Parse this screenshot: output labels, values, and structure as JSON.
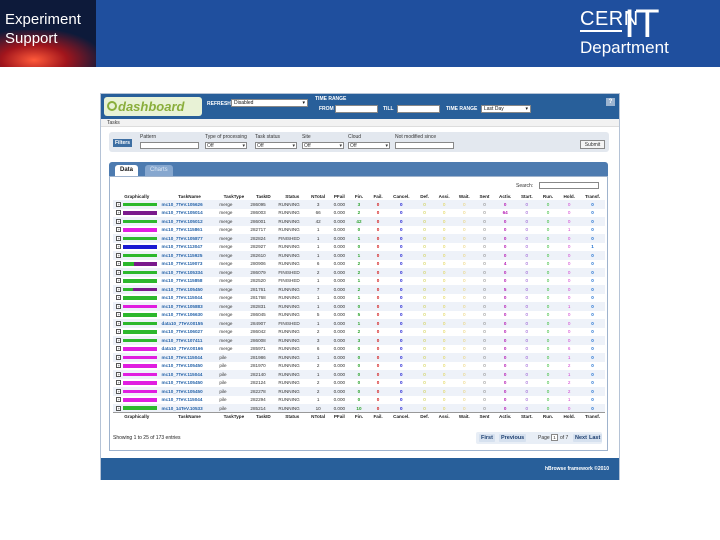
{
  "slide": {
    "left_title_line1": "Experiment",
    "left_title_line2": "Support",
    "org": "CERN",
    "org_it": "IT",
    "dept": "Department"
  },
  "toolbar": {
    "logo": "dashboard",
    "refresh_label": "REFRESH",
    "refresh_value": "Disabled",
    "time_range_title": "TIME RANGE",
    "from_label": "FROM",
    "till_label": "TILL",
    "time_range_label": "TIME RANGE",
    "time_range_value": "Last Day",
    "help": "?"
  },
  "tasks_bar": "Tasks",
  "filters": {
    "button": "Filters",
    "pattern_label": "Pattern",
    "type_label": "Type of processing",
    "type_value": "Off",
    "status_label": "Task status",
    "status_value": "Off",
    "site_label": "Site",
    "site_value": "Off",
    "cloud_label": "Cloud",
    "cloud_value": "Off",
    "notmod_label": "Not modified since",
    "submit": "Submit"
  },
  "tabs": {
    "data": "Data",
    "charts": "Charts"
  },
  "search_label": "Search:",
  "columns": [
    "Graphically",
    "TaskName",
    "TaskType",
    "TaskID",
    "Status",
    "NTotal",
    "PFail",
    "Fin.",
    "Fail.",
    "Cancel.",
    "Def.",
    "Assi.",
    "Wait.",
    "Sent",
    "Activ.",
    "Start.",
    "Run.",
    "Hold.",
    "Transf."
  ],
  "colors": {
    "green": "#2db82d",
    "purple": "#7a1a8c",
    "magenta": "#e01ee0",
    "blue": "#1a1ad2"
  },
  "rows": [
    {
      "g": [
        [
          "green",
          1
        ]
      ],
      "name": "mc10_7TeV.105626",
      "type": "merge",
      "id": "286095",
      "status": "RUNNING",
      "ntotal": "3",
      "pfail": "0.000",
      "fin": "3",
      "fail": "0",
      "canc": "0",
      "def": "0",
      "asi": "0",
      "wai": "0",
      "sen": "0",
      "act": "0",
      "sta": "0",
      "run": "0",
      "hol": "0",
      "tra": "0"
    },
    {
      "g": [
        [
          "purple",
          1
        ]
      ],
      "name": "mc10_7TeV.105014",
      "type": "merge",
      "id": "286003",
      "status": "RUNNING",
      "ntotal": "66",
      "pfail": "0.000",
      "fin": "2",
      "fail": "0",
      "canc": "0",
      "def": "0",
      "asi": "0",
      "wai": "0",
      "sen": "0",
      "act": "64",
      "sta": "0",
      "run": "0",
      "hol": "0",
      "tra": "0"
    },
    {
      "g": [
        [
          "green",
          1
        ]
      ],
      "name": "mc10_7TeV.105012",
      "type": "merge",
      "id": "286001",
      "status": "RUNNING",
      "ntotal": "42",
      "pfail": "0.000",
      "fin": "42",
      "fail": "0",
      "canc": "0",
      "def": "0",
      "asi": "0",
      "wai": "0",
      "sen": "0",
      "act": "0",
      "sta": "0",
      "run": "0",
      "hol": "0",
      "tra": "0"
    },
    {
      "g": [
        [
          "magenta",
          1
        ]
      ],
      "name": "mc10_7TeV.115861",
      "type": "merge",
      "id": "282717",
      "status": "RUNNING",
      "ntotal": "1",
      "pfail": "0.000",
      "fin": "0",
      "fail": "0",
      "canc": "0",
      "def": "0",
      "asi": "0",
      "wai": "0",
      "sen": "0",
      "act": "0",
      "sta": "0",
      "run": "0",
      "hol": "1",
      "tra": "0"
    },
    {
      "g": [
        [
          "green",
          1
        ]
      ],
      "name": "mc10_7TeV.105877",
      "type": "merge",
      "id": "282824",
      "status": "FINISHED",
      "ntotal": "1",
      "pfail": "0.000",
      "fin": "1",
      "fail": "0",
      "canc": "0",
      "def": "0",
      "asi": "0",
      "wai": "0",
      "sen": "0",
      "act": "0",
      "sta": "0",
      "run": "0",
      "hol": "0",
      "tra": "0"
    },
    {
      "g": [
        [
          "blue",
          1
        ]
      ],
      "name": "mc10_7TeV.113047",
      "type": "merge",
      "id": "282927",
      "status": "RUNNING",
      "ntotal": "1",
      "pfail": "0.000",
      "fin": "0",
      "fail": "0",
      "canc": "0",
      "def": "0",
      "asi": "0",
      "wai": "0",
      "sen": "0",
      "act": "0",
      "sta": "0",
      "run": "0",
      "hol": "0",
      "tra": "1"
    },
    {
      "g": [
        [
          "green",
          1
        ]
      ],
      "name": "mc10_7TeV.115925",
      "type": "merge",
      "id": "282610",
      "status": "RUNNING",
      "ntotal": "1",
      "pfail": "0.000",
      "fin": "1",
      "fail": "0",
      "canc": "0",
      "def": "0",
      "asi": "0",
      "wai": "0",
      "sen": "0",
      "act": "0",
      "sta": "0",
      "run": "0",
      "hol": "0",
      "tra": "0"
    },
    {
      "g": [
        [
          "green",
          0.33
        ],
        [
          "purple",
          0.67
        ]
      ],
      "name": "mc10_7TeV.119073",
      "type": "merge",
      "id": "280906",
      "status": "RUNNING",
      "ntotal": "6",
      "pfail": "0.000",
      "fin": "2",
      "fail": "0",
      "canc": "0",
      "def": "0",
      "asi": "0",
      "wai": "0",
      "sen": "0",
      "act": "4",
      "sta": "0",
      "run": "0",
      "hol": "0",
      "tra": "0"
    },
    {
      "g": [
        [
          "green",
          1
        ]
      ],
      "name": "mc10_7TeV.105334",
      "type": "merge",
      "id": "286079",
      "status": "FINISHED",
      "ntotal": "2",
      "pfail": "0.000",
      "fin": "2",
      "fail": "0",
      "canc": "0",
      "def": "0",
      "asi": "0",
      "wai": "0",
      "sen": "0",
      "act": "0",
      "sta": "0",
      "run": "0",
      "hol": "0",
      "tra": "0"
    },
    {
      "g": [
        [
          "green",
          1
        ]
      ],
      "name": "mc10_7TeV.115858",
      "type": "merge",
      "id": "282520",
      "status": "FINISHED",
      "ntotal": "1",
      "pfail": "0.000",
      "fin": "1",
      "fail": "0",
      "canc": "0",
      "def": "0",
      "asi": "0",
      "wai": "0",
      "sen": "0",
      "act": "0",
      "sta": "0",
      "run": "0",
      "hol": "0",
      "tra": "0"
    },
    {
      "g": [
        [
          "green",
          0.29
        ],
        [
          "purple",
          0.71
        ]
      ],
      "name": "mc10_7TeV.105450",
      "type": "merge",
      "id": "281761",
      "status": "RUNNING",
      "ntotal": "7",
      "pfail": "0.000",
      "fin": "2",
      "fail": "0",
      "canc": "0",
      "def": "0",
      "asi": "0",
      "wai": "0",
      "sen": "0",
      "act": "5",
      "sta": "0",
      "run": "0",
      "hol": "0",
      "tra": "0"
    },
    {
      "g": [
        [
          "green",
          1
        ]
      ],
      "name": "mc10_7TeV.115044",
      "type": "merge",
      "id": "281768",
      "status": "RUNNING",
      "ntotal": "1",
      "pfail": "0.000",
      "fin": "1",
      "fail": "0",
      "canc": "0",
      "def": "0",
      "asi": "0",
      "wai": "0",
      "sen": "0",
      "act": "0",
      "sta": "0",
      "run": "0",
      "hol": "0",
      "tra": "0"
    },
    {
      "g": [
        [
          "magenta",
          1
        ]
      ],
      "name": "mc10_7TeV.105883",
      "type": "merge",
      "id": "282831",
      "status": "RUNNING",
      "ntotal": "1",
      "pfail": "0.000",
      "fin": "0",
      "fail": "0",
      "canc": "0",
      "def": "0",
      "asi": "0",
      "wai": "0",
      "sen": "0",
      "act": "0",
      "sta": "0",
      "run": "0",
      "hol": "1",
      "tra": "0"
    },
    {
      "g": [
        [
          "green",
          1
        ]
      ],
      "name": "mc10_7TeV.106630",
      "type": "merge",
      "id": "286045",
      "status": "RUNNING",
      "ntotal": "5",
      "pfail": "0.000",
      "fin": "5",
      "fail": "0",
      "canc": "0",
      "def": "0",
      "asi": "0",
      "wai": "0",
      "sen": "0",
      "act": "0",
      "sta": "0",
      "run": "0",
      "hol": "0",
      "tra": "0"
    },
    {
      "g": [
        [
          "green",
          1
        ]
      ],
      "name": "data10_7TeV.00155",
      "type": "merge",
      "id": "284907",
      "status": "FINISHED",
      "ntotal": "1",
      "pfail": "0.000",
      "fin": "1",
      "fail": "0",
      "canc": "0",
      "def": "0",
      "asi": "0",
      "wai": "0",
      "sen": "0",
      "act": "0",
      "sta": "0",
      "run": "0",
      "hol": "0",
      "tra": "0"
    },
    {
      "g": [
        [
          "green",
          1
        ]
      ],
      "name": "mc10_7TeV.106027",
      "type": "merge",
      "id": "286042",
      "status": "RUNNING",
      "ntotal": "2",
      "pfail": "0.000",
      "fin": "2",
      "fail": "0",
      "canc": "0",
      "def": "0",
      "asi": "0",
      "wai": "0",
      "sen": "0",
      "act": "0",
      "sta": "0",
      "run": "0",
      "hol": "0",
      "tra": "0"
    },
    {
      "g": [
        [
          "green",
          1
        ]
      ],
      "name": "mc10_7TeV.107411",
      "type": "merge",
      "id": "286008",
      "status": "RUNNING",
      "ntotal": "3",
      "pfail": "0.000",
      "fin": "3",
      "fail": "0",
      "canc": "0",
      "def": "0",
      "asi": "0",
      "wai": "0",
      "sen": "0",
      "act": "0",
      "sta": "0",
      "run": "0",
      "hol": "0",
      "tra": "0"
    },
    {
      "g": [
        [
          "magenta",
          1
        ]
      ],
      "name": "data10_7TeV.00166",
      "type": "merge",
      "id": "285971",
      "status": "RUNNING",
      "ntotal": "6",
      "pfail": "0.000",
      "fin": "0",
      "fail": "0",
      "canc": "0",
      "def": "0",
      "asi": "0",
      "wai": "0",
      "sen": "0",
      "act": "0",
      "sta": "0",
      "run": "0",
      "hol": "6",
      "tra": "0"
    },
    {
      "g": [
        [
          "magenta",
          1
        ]
      ],
      "name": "mc10_7TeV.115044",
      "type": "pile",
      "id": "281986",
      "status": "RUNNING",
      "ntotal": "1",
      "pfail": "0.000",
      "fin": "0",
      "fail": "0",
      "canc": "0",
      "def": "0",
      "asi": "0",
      "wai": "0",
      "sen": "0",
      "act": "0",
      "sta": "0",
      "run": "0",
      "hol": "1",
      "tra": "0"
    },
    {
      "g": [
        [
          "magenta",
          1
        ]
      ],
      "name": "mc10_7TeV.105450",
      "type": "pile",
      "id": "281970",
      "status": "RUNNING",
      "ntotal": "2",
      "pfail": "0.000",
      "fin": "0",
      "fail": "0",
      "canc": "0",
      "def": "0",
      "asi": "0",
      "wai": "0",
      "sen": "0",
      "act": "0",
      "sta": "0",
      "run": "0",
      "hol": "2",
      "tra": "0"
    },
    {
      "g": [
        [
          "magenta",
          1
        ]
      ],
      "name": "mc10_7TeV.115044",
      "type": "pile",
      "id": "282140",
      "status": "RUNNING",
      "ntotal": "1",
      "pfail": "0.000",
      "fin": "0",
      "fail": "0",
      "canc": "0",
      "def": "0",
      "asi": "0",
      "wai": "0",
      "sen": "0",
      "act": "0",
      "sta": "0",
      "run": "0",
      "hol": "1",
      "tra": "0"
    },
    {
      "g": [
        [
          "magenta",
          1
        ]
      ],
      "name": "mc10_7TeV.105450",
      "type": "pile",
      "id": "282124",
      "status": "RUNNING",
      "ntotal": "2",
      "pfail": "0.000",
      "fin": "0",
      "fail": "0",
      "canc": "0",
      "def": "0",
      "asi": "0",
      "wai": "0",
      "sen": "0",
      "act": "0",
      "sta": "0",
      "run": "0",
      "hol": "2",
      "tra": "0"
    },
    {
      "g": [
        [
          "magenta",
          1
        ]
      ],
      "name": "mc10_7TeV.105450",
      "type": "pile",
      "id": "282278",
      "status": "RUNNING",
      "ntotal": "2",
      "pfail": "0.000",
      "fin": "0",
      "fail": "0",
      "canc": "0",
      "def": "0",
      "asi": "0",
      "wai": "0",
      "sen": "0",
      "act": "0",
      "sta": "0",
      "run": "0",
      "hol": "2",
      "tra": "0"
    },
    {
      "g": [
        [
          "magenta",
          1
        ]
      ],
      "name": "mc10_7TeV.115044",
      "type": "pile",
      "id": "282294",
      "status": "RUNNING",
      "ntotal": "1",
      "pfail": "0.000",
      "fin": "0",
      "fail": "0",
      "canc": "0",
      "def": "0",
      "asi": "0",
      "wai": "0",
      "sen": "0",
      "act": "0",
      "sta": "0",
      "run": "0",
      "hol": "1",
      "tra": "0"
    },
    {
      "g": [
        [
          "green",
          1
        ]
      ],
      "name": "mc10_14TeV.10533",
      "type": "pile",
      "id": "285214",
      "status": "RUNNING",
      "ntotal": "10",
      "pfail": "0.000",
      "fin": "10",
      "fail": "0",
      "canc": "0",
      "def": "0",
      "asi": "0",
      "wai": "0",
      "sen": "0",
      "act": "0",
      "sta": "0",
      "run": "0",
      "hol": "0",
      "tra": "0"
    }
  ],
  "info": "Showing 1 to 25 of 173 entries",
  "pager": {
    "first": "First",
    "previous": "Previous",
    "page_label": "Page",
    "page": "1",
    "of": "of 7",
    "next": "Next",
    "last": "Last"
  },
  "footer": "hBrowse framework ©2010"
}
